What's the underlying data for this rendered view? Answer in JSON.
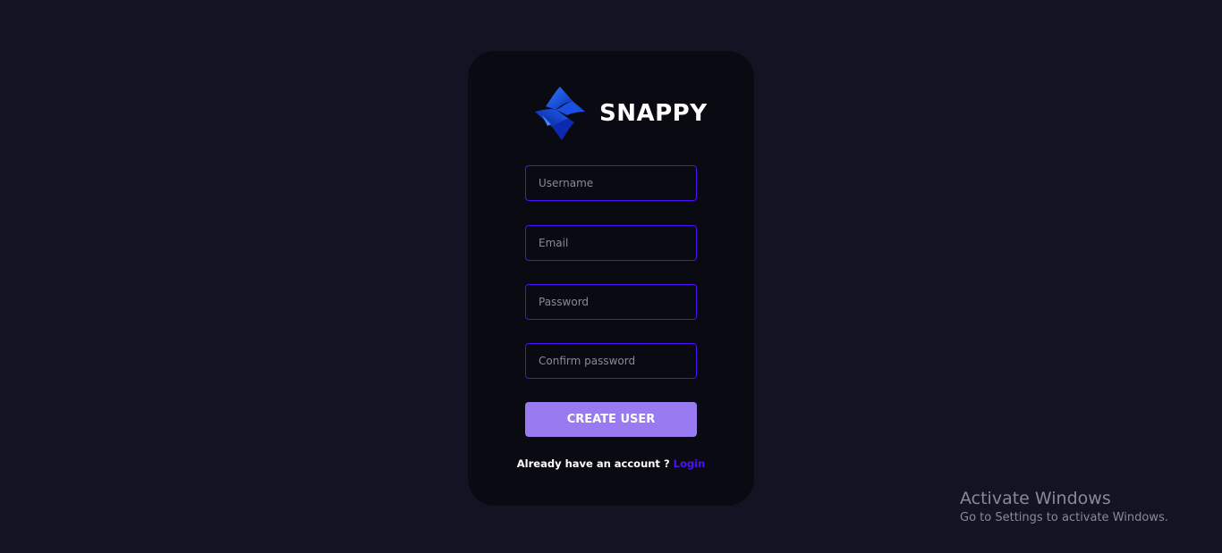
{
  "brand": {
    "name": "SNAPPY",
    "logo_icon": "snappy-logo-icon"
  },
  "form": {
    "username_placeholder": "Username",
    "email_placeholder": "Email",
    "password_placeholder": "Password",
    "confirm_password_placeholder": "Confirm password",
    "submit_label": "Create User",
    "footer_text": "Already have an account ? ",
    "login_link": "Login"
  },
  "watermark": {
    "title": "Activate Windows",
    "subtitle": "Go to Settings to activate Windows."
  },
  "colors": {
    "background": "#131324",
    "card": "#0a0a12",
    "accent": "#4e0eff",
    "button": "#997af0"
  }
}
